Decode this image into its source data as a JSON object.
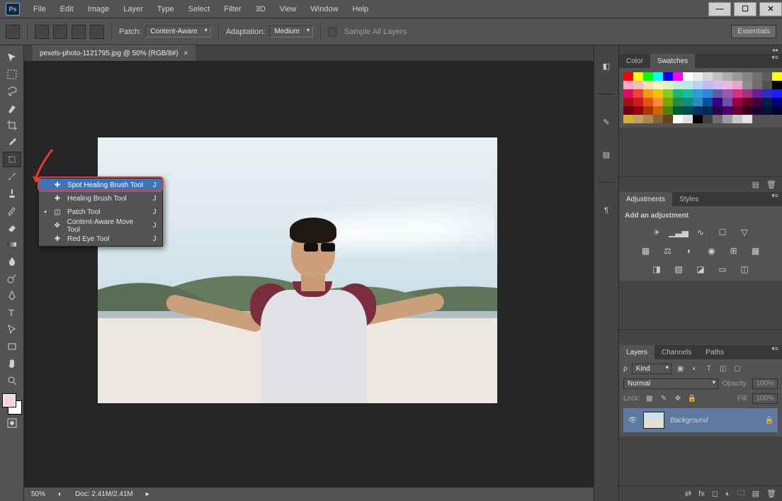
{
  "menu": {
    "file": "File",
    "edit": "Edit",
    "image": "Image",
    "layer": "Layer",
    "type": "Type",
    "select": "Select",
    "filter": "Filter",
    "threeD": "3D",
    "view": "View",
    "window": "Window",
    "help": "Help"
  },
  "window_controls": {
    "min": "—",
    "max": "☐",
    "close": "✕"
  },
  "options_bar": {
    "patch_label": "Patch:",
    "patch_value": "Content-Aware",
    "adaptation_label": "Adaptation:",
    "adaptation_value": "Medium",
    "sample_all_layers": "Sample All Layers",
    "essentials": "Essentials"
  },
  "document": {
    "tab_title": "pexels-photo-1121795.jpg @ 50% (RGB/8#)",
    "zoom": "50%",
    "doc_size": "Doc: 2.41M/2.41M"
  },
  "healing_flyout": {
    "items": [
      {
        "label": "Spot Healing Brush Tool",
        "shortcut": "J",
        "selected": false,
        "hover": true
      },
      {
        "label": "Healing Brush Tool",
        "shortcut": "J",
        "selected": false,
        "hover": false
      },
      {
        "label": "Patch Tool",
        "shortcut": "J",
        "selected": true,
        "hover": false
      },
      {
        "label": "Content-Aware Move Tool",
        "shortcut": "J",
        "selected": false,
        "hover": false
      },
      {
        "label": "Red Eye Tool",
        "shortcut": "J",
        "selected": false,
        "hover": false
      }
    ]
  },
  "panels": {
    "color_tab": "Color",
    "swatches_tab": "Swatches",
    "adjustments_tab": "Adjustments",
    "styles_tab": "Styles",
    "add_adjustment": "Add an adjustment",
    "layers_tab": "Layers",
    "channels_tab": "Channels",
    "paths_tab": "Paths"
  },
  "layers": {
    "kind_label": "Kind",
    "blend_mode": "Normal",
    "opacity_label": "Opacity:",
    "opacity_value": "100%",
    "lock_label": "Lock:",
    "fill_label": "Fill:",
    "fill_value": "100%",
    "layer_name": "Background"
  },
  "swatch_colors": [
    "#ff0000",
    "#ffff00",
    "#00ff00",
    "#00ffff",
    "#0000ff",
    "#ff00ff",
    "#ffffff",
    "#ebebeb",
    "#d6d6d6",
    "#c2c2c2",
    "#adadad",
    "#999999",
    "#858585",
    "#707070",
    "#5c5c5c",
    "#ffff00",
    "#f5a7c4",
    "#f7bdbd",
    "#fbe2b6",
    "#fff7bd",
    "#def4c6",
    "#bef0d9",
    "#b8eaf0",
    "#b7d6f1",
    "#bdbdf1",
    "#d7bdec",
    "#ecb8e0",
    "#e4a5ce",
    "#8b8b8b",
    "#6e6e6e",
    "#525252",
    "#000000",
    "#e30b5d",
    "#ea4335",
    "#f39c12",
    "#f1c40f",
    "#8ac926",
    "#1cb56c",
    "#1abc9c",
    "#3498db",
    "#2e86de",
    "#5b5ea6",
    "#9b59b6",
    "#d63384",
    "#a83279",
    "#6a1b9a",
    "#2d2dbd",
    "#1b1bff",
    "#a50f15",
    "#cb181d",
    "#e6550d",
    "#fd8d3c",
    "#74a901",
    "#238b45",
    "#0e8b8b",
    "#2b8cbe",
    "#08519c",
    "#3f007d",
    "#6a51a3",
    "#980043",
    "#67001f",
    "#400040",
    "#001f4d",
    "#00007a",
    "#67000d",
    "#99000d",
    "#a63603",
    "#cc6600",
    "#4b830d",
    "#005a32",
    "#004d4d",
    "#08306b",
    "#002855",
    "#2a004d",
    "#4a0072",
    "#660033",
    "#330019",
    "#1a0033",
    "#001433",
    "#000033",
    "#d4af37",
    "#c0a060",
    "#a88b4a",
    "#87643b",
    "#654321",
    "#ffffff",
    "#e0e0e0",
    "#000000",
    "#3f3f3f",
    "#6e6e6e",
    "#9c9c9c",
    "#c8c8c8",
    "#e3e3e3",
    "",
    "",
    ""
  ]
}
